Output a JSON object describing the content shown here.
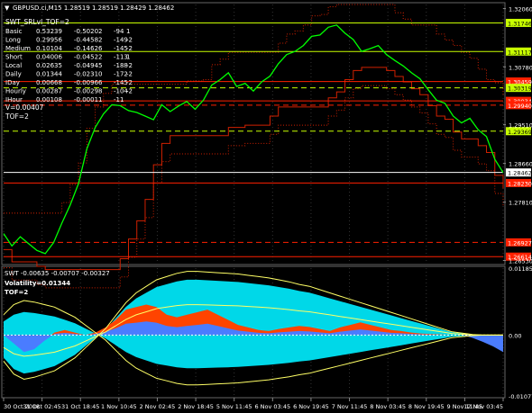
{
  "header": {
    "symbol_line": "GBPUSD.ci,M15  1.28519 1.28519 1.28429 1.28462",
    "indicator_name": "SWT_SRLvl_TOF=2"
  },
  "stats": [
    [
      "Basic",
      "0.53239",
      "-0.50202",
      "-94",
      "1"
    ],
    [
      "Long",
      "0.29956",
      "-0.44582",
      "-149",
      "-2"
    ],
    [
      "Medium",
      "0.10104",
      "-0.14626",
      "-145",
      "-2"
    ],
    [
      "Short",
      "0.04006",
      "-0.04522",
      "-113",
      "1"
    ],
    [
      "Local",
      "0.02635",
      "-0.04945",
      "-188",
      "-2"
    ],
    [
      "Daily",
      "0.01344",
      "-0.02310",
      "-172",
      "-2"
    ],
    [
      "IDay",
      "0.00668",
      "-0.00966",
      "-145",
      "-2"
    ],
    [
      "Hourly",
      "0.00287",
      "-0.00298",
      "-104",
      "-2"
    ],
    [
      "IHour",
      "0.00108",
      "-0.00011",
      "-11",
      ""
    ]
  ],
  "v_line": "V=0.00407",
  "tof_line": "TOF=2",
  "sub_header": {
    "line1": "SWT -0.00635 -0.00707 -0.00327",
    "line2": "Volatility=0.01344",
    "line3": "TOF=2"
  },
  "colors": {
    "price": "#00ff00",
    "level_green": "#c8ff00",
    "level_red": "#ff2000",
    "dotted_red": "#d02000",
    "fill_orange": "#ff4400",
    "fill_cyan": "#00d8e8",
    "fill_blue": "#4a7cff",
    "band_yellow": "#ffff66"
  },
  "chart_data": {
    "type": "line",
    "symbol": "GBPUSD.ci",
    "timeframe": "M15",
    "x_tick_labels": [
      "30 Oct 2018",
      "31 Oct 02:45",
      "31 Oct 18:45",
      "1 Nov 10:45",
      "2 Nov 02:45",
      "2 Nov 18:45",
      "5 Nov 11:45",
      "6 Nov 03:45",
      "6 Nov 19:45",
      "7 Nov 11:45",
      "8 Nov 03:45",
      "8 Nov 19:45",
      "9 Nov 11:45",
      "12 Nov 03:45"
    ],
    "y_tick_labels": [
      "1.32060",
      "1.30780",
      "1.29510",
      "1.28660",
      "1.27810",
      "1.26530"
    ],
    "ylim": [
      1.2648,
      1.3215
    ],
    "close": [
      1.2712,
      1.2685,
      1.2705,
      1.269,
      1.2675,
      1.2668,
      1.2692,
      1.2735,
      1.2775,
      1.2822,
      1.2898,
      1.2945,
      1.2975,
      1.2995,
      1.2993,
      1.2982,
      1.2978,
      1.297,
      1.2962,
      1.2995,
      1.298,
      1.2992,
      1.3002,
      1.2985,
      1.3005,
      1.3038,
      1.305,
      1.3065,
      1.3035,
      1.3042,
      1.3025,
      1.3045,
      1.3058,
      1.3085,
      1.3105,
      1.3112,
      1.3125,
      1.3145,
      1.3148,
      1.3165,
      1.317,
      1.3152,
      1.3138,
      1.3112,
      1.3118,
      1.3125,
      1.3105,
      1.3092,
      1.308,
      1.3065,
      1.3052,
      1.3028,
      1.3005,
      1.2998,
      1.297,
      1.2955,
      1.2965,
      1.294,
      1.2925,
      1.2875,
      1.2846
    ],
    "levels": [
      {
        "price": 1.31746,
        "label": "1.31746",
        "color": "green",
        "style": "solid"
      },
      {
        "price": 1.31117,
        "label": "1.31117",
        "color": "green",
        "style": "solid"
      },
      {
        "price": 1.30459,
        "label": "1.30459",
        "color": "red",
        "style": "solid"
      },
      {
        "price": 1.30319,
        "label": "1.30319",
        "color": "green",
        "style": "dashed"
      },
      {
        "price": 1.30034,
        "label": "1.30034",
        "color": "red",
        "style": "solid"
      },
      {
        "price": 1.2994,
        "label": "1.29940",
        "color": "red",
        "style": "dashed"
      },
      {
        "price": 1.29369,
        "label": "1.29369",
        "color": "green",
        "style": "dashed"
      },
      {
        "price": 1.28462,
        "label": "1.28462",
        "color": "white",
        "style": "solid"
      },
      {
        "price": 1.2823,
        "label": "1.28230",
        "color": "red",
        "style": "solid"
      },
      {
        "price": 1.26927,
        "label": "1.26927",
        "color": "red",
        "style": "dashed"
      },
      {
        "price": 1.26614,
        "label": "1.26614",
        "color": "red",
        "style": "solid"
      }
    ],
    "sub_ylim": [
      -0.01077,
      0.01185
    ],
    "sub_y_tick_labels": [
      "0.01185",
      "0.00",
      "-0.01077"
    ],
    "orange": [
      0.0,
      -0.0015,
      -0.003,
      -0.0025,
      -0.001,
      0.0005,
      0.001,
      0.0005,
      0.0,
      0.0005,
      0.0015,
      0.003,
      0.005,
      0.0055,
      0.006,
      0.0055,
      0.004,
      0.0035,
      0.004,
      0.0045,
      0.005,
      0.004,
      0.003,
      0.002,
      0.0015,
      0.001,
      0.0008,
      0.0012,
      0.0015,
      0.0018,
      0.0016,
      0.0012,
      0.0008,
      0.0015,
      0.002,
      0.0025,
      0.002,
      0.0015,
      0.001,
      0.0008,
      0.0005,
      0.0003,
      0.0002,
      0.0001,
      0.0,
      0.0,
      -0.0005,
      -0.0012,
      -0.002,
      -0.003
    ],
    "cyan": [
      -0.004,
      -0.006,
      -0.0068,
      -0.0065,
      -0.006,
      -0.0055,
      -0.0045,
      -0.0035,
      -0.002,
      -0.0005,
      0.001,
      0.003,
      0.005,
      0.0065,
      0.0075,
      0.0085,
      0.009,
      0.0095,
      0.0098,
      0.0098,
      0.0097,
      0.0096,
      0.0095,
      0.0094,
      0.0092,
      0.009,
      0.0088,
      0.0085,
      0.0082,
      0.0078,
      0.0075,
      0.007,
      0.0065,
      0.006,
      0.0055,
      0.005,
      0.0045,
      0.004,
      0.0035,
      0.003,
      0.0025,
      0.002,
      0.0015,
      0.001,
      0.0005,
      0.0003,
      0.0001,
      0.0,
      0.0,
      0.0
    ]
  }
}
